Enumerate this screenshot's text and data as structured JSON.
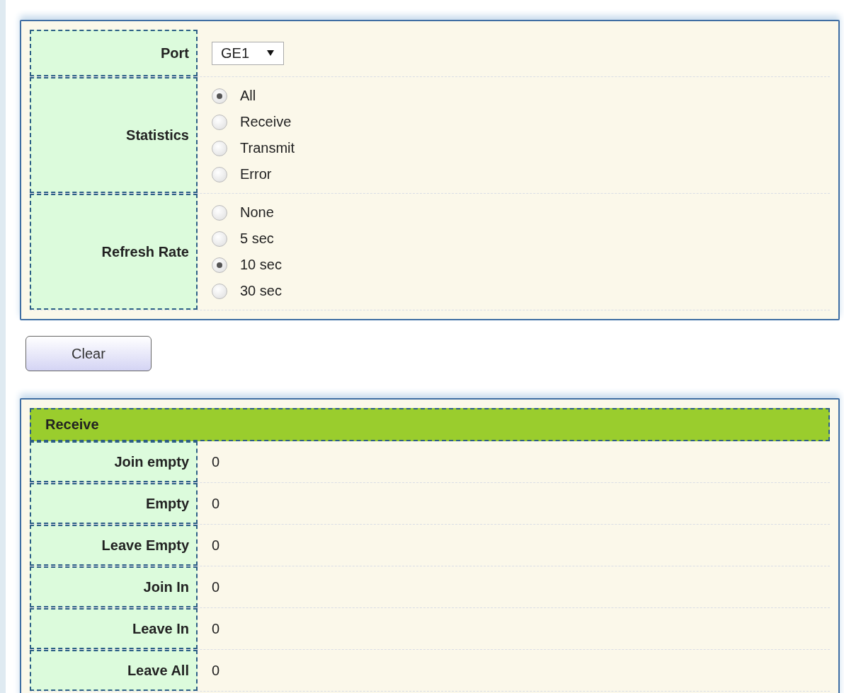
{
  "settings": {
    "port": {
      "label": "Port",
      "value": "GE1"
    },
    "groups": [
      {
        "label": "Statistics",
        "options": [
          {
            "label": "All",
            "selected": true
          },
          {
            "label": "Receive",
            "selected": false
          },
          {
            "label": "Transmit",
            "selected": false
          },
          {
            "label": "Error",
            "selected": false
          }
        ]
      },
      {
        "label": "Refresh Rate",
        "options": [
          {
            "label": "None",
            "selected": false
          },
          {
            "label": "5 sec",
            "selected": false
          },
          {
            "label": "10 sec",
            "selected": true
          },
          {
            "label": "30 sec",
            "selected": false
          }
        ]
      }
    ]
  },
  "clear_button": "Clear",
  "receive": {
    "title": "Receive",
    "rows": [
      {
        "label": "Join empty",
        "value": "0"
      },
      {
        "label": "Empty",
        "value": "0"
      },
      {
        "label": "Leave Empty",
        "value": "0"
      },
      {
        "label": "Join In",
        "value": "0"
      },
      {
        "label": "Leave In",
        "value": "0"
      },
      {
        "label": "Leave All",
        "value": "0"
      }
    ]
  }
}
